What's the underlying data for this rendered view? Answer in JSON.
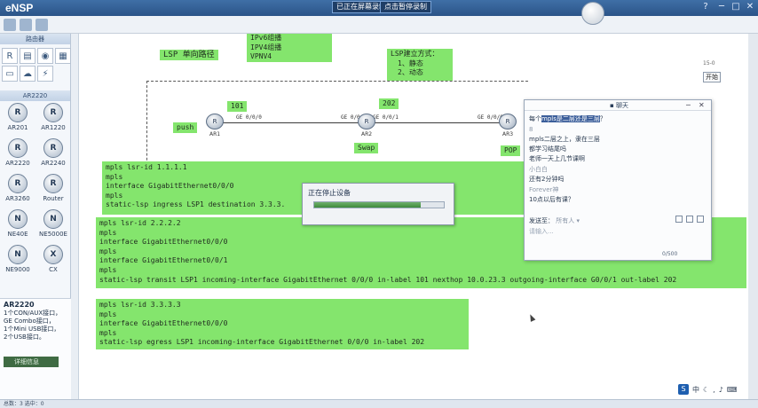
{
  "app": {
    "title": "eNSP"
  },
  "titlebar": {
    "recording_label": "已正在屏幕录制",
    "pause_label": "点击暂停录制",
    "min_label": "─",
    "max_label": "□",
    "close_label": "✕",
    "help_label": "?"
  },
  "left_panel": {
    "header": "路由器",
    "category_icons": [
      "router-icon",
      "switch-icon",
      "wlan-icon",
      "firewall-icon",
      "pc-icon",
      "cloud-icon",
      "power-icon"
    ],
    "model_header": "AR2220",
    "devices": [
      {
        "label": "AR201"
      },
      {
        "label": "AR1220"
      },
      {
        "label": "AR2220"
      },
      {
        "label": "AR2240"
      },
      {
        "label": "AR3260"
      },
      {
        "label": "Router"
      },
      {
        "label": "NE40E"
      },
      {
        "label": "NE5000E"
      },
      {
        "label": "NE9000"
      },
      {
        "label": "CX"
      }
    ],
    "info": {
      "title": "AR2220",
      "lines": [
        "1个CON/AUX接口，",
        "GE Combo接口，",
        "1个Mini USB接口，",
        "2个USB接口。"
      ],
      "button_label": "详细信息"
    }
  },
  "canvas": {
    "top_box_lines": [
      "IPv6组播",
      "IPV4组播",
      "VPNV4"
    ],
    "lsp_title": "LSP 单向路径",
    "lsp_setup": [
      "LSP建立方式：",
      "1、静态",
      "2、动态"
    ],
    "label_101": "101",
    "label_202": "202",
    "push_label": "push",
    "swap_label": "Swap",
    "pop_label": "POP",
    "routers": [
      {
        "name": "AR1",
        "iface": "GE 0/0/0"
      },
      {
        "name": "AR2",
        "iface_left": "GE 0/0/0",
        "iface_right": "GE 0/0/1"
      },
      {
        "name": "AR3",
        "iface": "GE 0/0/0"
      }
    ],
    "config_ar1": [
      "mpls lsr-id 1.1.1.1",
      "mpls",
      "interface GigabitEthernet0/0/0",
      "mpls",
      "static-lsp ingress LSP1 destination 3.3.3.                       -interface g0/0/"
    ],
    "config_ar2": [
      "mpls lsr-id 2.2.2.2",
      "mpls",
      "interface GigabitEthernet0/0/0",
      "mpls",
      "interface GigabitEthernet0/0/1",
      "mpls",
      "static-lsp transit LSP1 incoming-interface GigabitEthernet 0/0/0 in-label 101 nexthop 10.0.23.3 outgoing-interface G0/0/1 out-label 202"
    ],
    "config_ar3": [
      "mpls lsr-id 3.3.3.3",
      "mpls",
      "interface GigabitEthernet0/0/0",
      "mpls",
      "static-lsp egress LSP1 incoming-interface GigabitEthernet 0/0/0 in-label 202"
    ],
    "side_button": "开始",
    "side_small": "15-0"
  },
  "progress_dialog": {
    "title": "正在停止设备",
    "progress": 0.82
  },
  "chat": {
    "title": "聊天",
    "messages": [
      {
        "text": "每个",
        "highlight": "mpls是二层还是三层",
        "tail": "？"
      },
      {
        "text": "8"
      },
      {
        "text": "mpls二层之上，隶在三层"
      },
      {
        "text": "都学习结尾吗"
      },
      {
        "text": "老师一天上几节课啊"
      },
      {
        "text": "小白白",
        "dim": true
      },
      {
        "text": "还有2分钟吗"
      },
      {
        "text": "Forever神",
        "dim": true
      },
      {
        "text": "10点以后有课？"
      }
    ],
    "send_to_label": "发送至：",
    "send_to_value": "所有人 ▾",
    "input_placeholder": "请输入...",
    "char_count": "0/500"
  },
  "statusbar": {
    "text": "总数：3  选中：0"
  }
}
